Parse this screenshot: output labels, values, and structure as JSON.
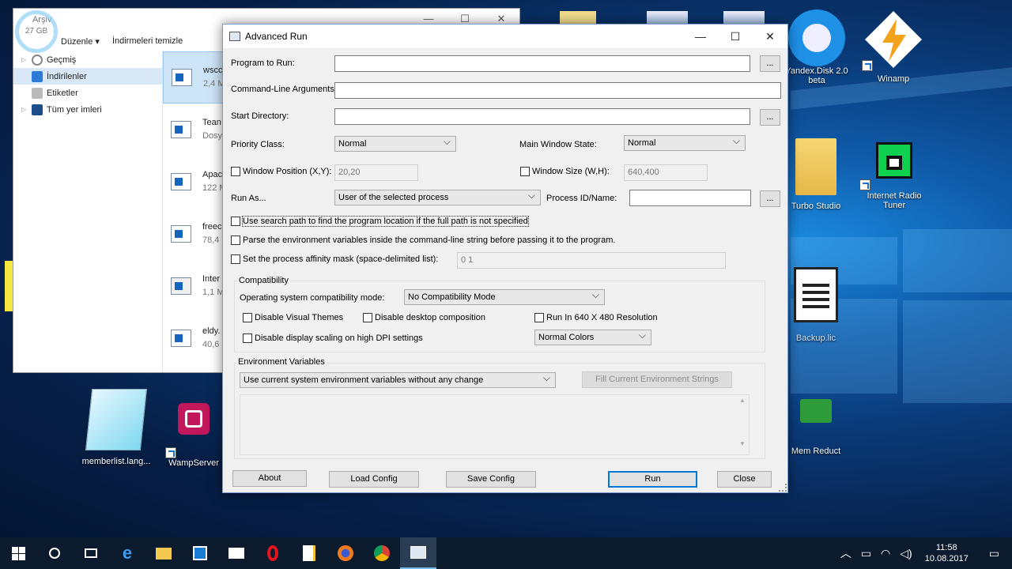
{
  "explorer": {
    "title": "Arşiv",
    "disk": "27 GB",
    "menu_edit": "Düzenle",
    "clear_downloads": "İndirmeleri temizle",
    "nav": [
      {
        "label": "Geçmiş"
      },
      {
        "label": "İndirilenler"
      },
      {
        "label": "Etiketler"
      },
      {
        "label": "Tüm yer imleri"
      }
    ],
    "files": [
      {
        "name": "wscc",
        "size": "2,4 M"
      },
      {
        "name": "Tean",
        "size": "Dosy"
      },
      {
        "name": "Apac",
        "size": "122 M"
      },
      {
        "name": "freec",
        "size": "78,4"
      },
      {
        "name": "Inter",
        "size": "1,1 M"
      },
      {
        "name": "eldy.",
        "size": "40,6"
      }
    ]
  },
  "desktop": {
    "icons": [
      {
        "label": "Yandex.Disk 2.0 beta"
      },
      {
        "label": "Winamp"
      },
      {
        "label": "Turbo Studio"
      },
      {
        "label": "Internet Radio Tuner"
      },
      {
        "label": "Backup.lic"
      },
      {
        "label": "Mem Reduct"
      },
      {
        "label": "memberlist.lang..."
      },
      {
        "label": "WampServer"
      }
    ]
  },
  "dialog": {
    "title": "Advanced Run",
    "program_label": "Program to Run:",
    "program_value": "",
    "args_label": "Command-Line Arguments:",
    "args_value": "",
    "startdir_label": "Start Directory:",
    "startdir_value": "",
    "browse": "...",
    "priority_label": "Priority Class:",
    "priority_value": "Normal",
    "winstate_label": "Main Window State:",
    "winstate_value": "Normal",
    "winpos_label": "Window Position (X,Y):",
    "winpos_value": "20,20",
    "winsize_label": "Window Size (W,H):",
    "winsize_value": "640,400",
    "runas_label": "Run As...",
    "runas_value": "User of the selected process",
    "pid_label": "Process ID/Name:",
    "pid_value": "",
    "opt_search_path": "Use search path to find the program location if the full path is not specified",
    "opt_parse_env": "Parse the environment variables inside the command-line string before passing it to the program.",
    "opt_affinity": "Set the process affinity mask (space-delimited list):",
    "affinity_value": "0 1",
    "compat_group": "Compatibility",
    "compat_label": "Operating system compatibility mode:",
    "compat_value": "No Compatibility Mode",
    "opt_visual_themes": "Disable Visual Themes",
    "opt_desktop_comp": "Disable desktop composition",
    "opt_640": "Run In 640 X 480 Resolution",
    "opt_dpi": "Disable display scaling on high DPI settings",
    "colors_value": "Normal Colors",
    "env_group": "Environment Variables",
    "env_value": "Use current system environment variables without any change",
    "fill_env": "Fill Current Environment Strings",
    "about": "About",
    "load": "Load Config",
    "save": "Save Config",
    "run": "Run",
    "close": "Close"
  },
  "taskbar": {
    "time": "11:58",
    "date": "10.08.2017"
  }
}
